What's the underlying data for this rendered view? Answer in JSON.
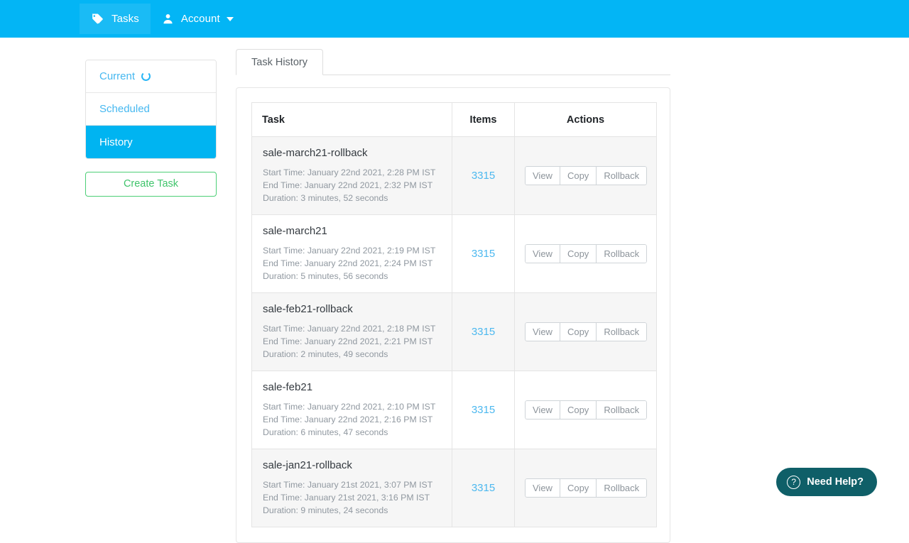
{
  "navbar": {
    "brand_color": "#03b5f5",
    "items": [
      {
        "label": "Tasks",
        "icon": "tag-icon",
        "active": true
      },
      {
        "label": "Account",
        "icon": "user-icon",
        "active": false,
        "has_caret": true
      }
    ]
  },
  "sidebar": {
    "items": [
      {
        "label": "Current",
        "active": false,
        "spinner": true
      },
      {
        "label": "Scheduled",
        "active": false,
        "spinner": false
      },
      {
        "label": "History",
        "active": true,
        "spinner": false
      }
    ],
    "create_button": "Create Task"
  },
  "main": {
    "tabs": [
      {
        "label": "Task History",
        "active": true
      }
    ],
    "table": {
      "headers": [
        "Task",
        "Items",
        "Actions"
      ],
      "rows": [
        {
          "task": "sale-march21-rollback",
          "start_time": "Start Time: January 22nd 2021, 2:28 PM IST",
          "end_time": "End Time: January 22nd 2021, 2:32 PM IST",
          "duration": "Duration: 3 minutes, 52 seconds",
          "items": "3315",
          "actions": [
            "View",
            "Copy",
            "Rollback"
          ]
        },
        {
          "task": "sale-march21",
          "start_time": "Start Time: January 22nd 2021, 2:19 PM IST",
          "end_time": "End Time: January 22nd 2021, 2:24 PM IST",
          "duration": "Duration: 5 minutes, 56 seconds",
          "items": "3315",
          "actions": [
            "View",
            "Copy",
            "Rollback"
          ]
        },
        {
          "task": "sale-feb21-rollback",
          "start_time": "Start Time: January 22nd 2021, 2:18 PM IST",
          "end_time": "End Time: January 22nd 2021, 2:21 PM IST",
          "duration": "Duration: 2 minutes, 49 seconds",
          "items": "3315",
          "actions": [
            "View",
            "Copy",
            "Rollback"
          ]
        },
        {
          "task": "sale-feb21",
          "start_time": "Start Time: January 22nd 2021, 2:10 PM IST",
          "end_time": "End Time: January 22nd 2021, 2:16 PM IST",
          "duration": "Duration: 6 minutes, 47 seconds",
          "items": "3315",
          "actions": [
            "View",
            "Copy",
            "Rollback"
          ]
        },
        {
          "task": "sale-jan21-rollback",
          "start_time": "Start Time: January 21st 2021, 3:07 PM IST",
          "end_time": "End Time: January 21st 2021, 3:16 PM IST",
          "duration": "Duration: 9 minutes, 24 seconds",
          "items": "3315",
          "actions": [
            "View",
            "Copy",
            "Rollback"
          ]
        }
      ]
    }
  },
  "help_widget": {
    "label": "Need Help?",
    "icon": "question-circle-icon",
    "color": "#0f5f68"
  }
}
